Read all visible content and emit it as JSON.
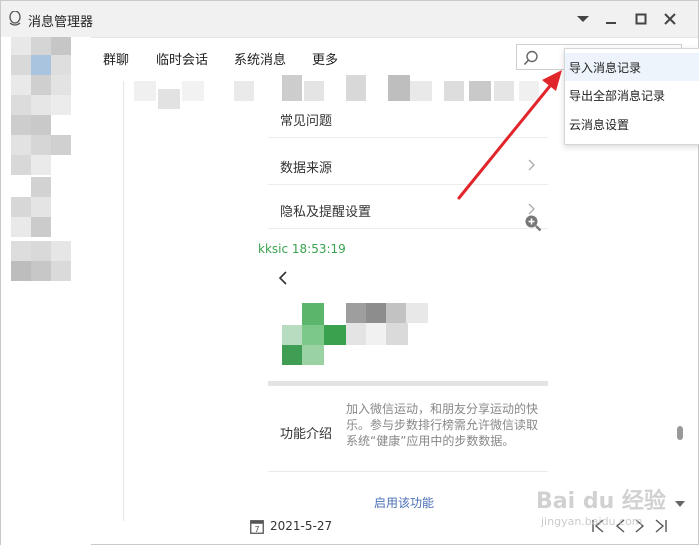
{
  "window": {
    "title": "消息管理器"
  },
  "tabs": [
    "群聊",
    "临时会话",
    "系统消息",
    "更多"
  ],
  "search": {
    "label": "搜索"
  },
  "dropdown": {
    "items": [
      "导入消息记录",
      "导出全部消息记录",
      "云消息设置"
    ]
  },
  "content": {
    "rows": [
      "常见问题",
      "数据来源",
      "隐私及提醒设置"
    ],
    "sender": "kksic 18:53:19",
    "feature_label": "功能介绍",
    "feature_desc": "加入微信运动，和朋友分享运动的快乐。参与步数排行榜需允许微信读取系统“健康”应用中的步数数据。",
    "enable_link": "启用该功能"
  },
  "bottom": {
    "date": "2021-5-27"
  },
  "watermark": {
    "main": "Bai du 经验",
    "sub": "jingyan.baidu.com"
  },
  "colors": {
    "accent_green": "#3aa24e",
    "link_blue": "#4a6fb5",
    "arrow_red": "#e0252b"
  }
}
